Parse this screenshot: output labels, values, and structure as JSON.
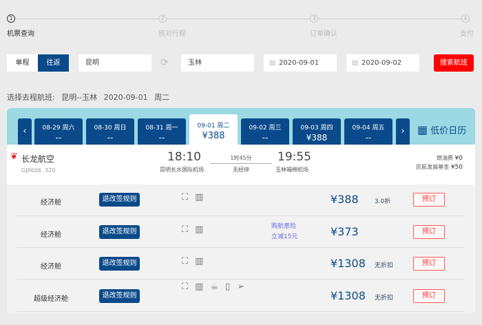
{
  "steps": [
    {
      "num": "1",
      "label": "机票查询",
      "active": true
    },
    {
      "num": "2",
      "label": "核对行程",
      "active": false
    },
    {
      "num": "3",
      "label": "订单确认",
      "active": false
    },
    {
      "num": "4",
      "label": "支付",
      "active": false
    }
  ],
  "search": {
    "one_way": "单程",
    "round_trip": "往返",
    "from": "昆明",
    "to": "玉林",
    "depart_date": "2020-09-01",
    "return_date": "2020-09-02",
    "search_button": "搜索航班"
  },
  "section_title": "选择去程航班:",
  "route": "昆明--玉林",
  "route_date": "2020-09-01",
  "route_weekday": "周二",
  "date_tabs": [
    {
      "date": "08-29 周六",
      "price": "--"
    },
    {
      "date": "08-30 周日",
      "price": "--"
    },
    {
      "date": "08-31 周一",
      "price": "--"
    },
    {
      "date": "09-01 周二",
      "price": "¥388",
      "selected": true
    },
    {
      "date": "09-02 周三",
      "price": "--"
    },
    {
      "date": "09-03 周四",
      "price": "¥388"
    },
    {
      "date": "09-04 周五",
      "price": "--"
    }
  ],
  "calendar_label": "低价日历",
  "flight": {
    "airline": "长龙航空",
    "flight_no": "GJ8606",
    "aircraft": "320",
    "dep_time": "18:10",
    "dep_airport": "昆明长水国际机场",
    "duration": "1时45分",
    "stops": "无经停",
    "arr_time": "19:55",
    "arr_airport": "玉林福绵机场",
    "fuel_label": "燃油费",
    "fuel": "¥0",
    "fund_label": "民航发展基金",
    "fund": "¥50"
  },
  "fares": [
    {
      "cabin": "经济舱",
      "rule": "退改签规则",
      "price": "¥388",
      "discount": "3.0折",
      "book": "预订",
      "promo": []
    },
    {
      "cabin": "经济舱",
      "rule": "退改签规则",
      "price": "¥373",
      "discount": "",
      "book": "预订",
      "promo": [
        "购航意险",
        "立减15元"
      ]
    },
    {
      "cabin": "经济舱",
      "rule": "退改签规则",
      "price": "¥1308",
      "discount": "无折扣",
      "book": "预订",
      "promo": []
    },
    {
      "cabin": "超级经济舱",
      "rule": "退改签规则",
      "price": "¥1308",
      "discount": "无折扣",
      "book": "预订",
      "promo": []
    }
  ],
  "colors": {
    "brand": "#0a4a8a",
    "accent": "#ff0000",
    "header": "#9bd9e4"
  }
}
